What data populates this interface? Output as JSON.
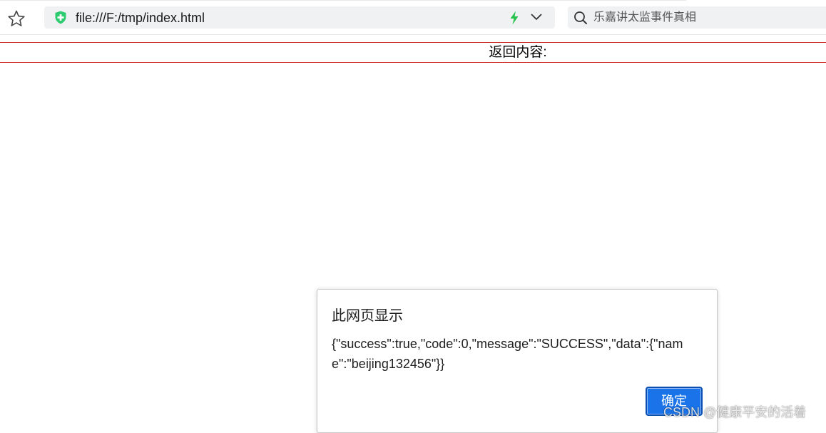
{
  "toolbar": {
    "url": "file:///F:/tmp/index.html",
    "search_placeholder": "乐嘉讲太监事件真相",
    "icons": {
      "bookmark": "star-icon",
      "site_status": "shield-icon",
      "fast_mode": "lightning-icon",
      "dropdown": "chevron-down-icon",
      "search": "search-icon"
    },
    "colors": {
      "shield": "#2ecc71",
      "bolt": "#27c24c"
    }
  },
  "page": {
    "result_label": "返回内容:",
    "border_color": "#cc2222"
  },
  "dialog": {
    "title": "此网页显示",
    "message": "{\"success\":true,\"code\":0,\"message\":\"SUCCESS\",\"data\":{\"name\":\"beijing132456\"}}",
    "ok_label": "确定",
    "button_color": "#1a73e8"
  },
  "watermark": "CSDN @健康平安的活着"
}
